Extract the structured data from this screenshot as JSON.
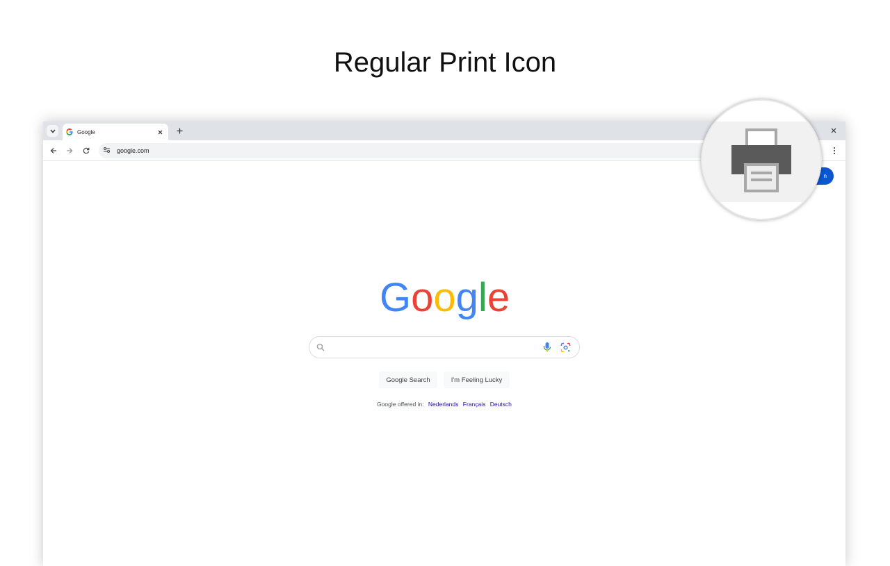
{
  "headline": "Regular Print Icon",
  "browser": {
    "tab": {
      "title": "Google"
    },
    "url": "google.com",
    "signin_label": "n"
  },
  "page": {
    "search_placeholder": "",
    "buttons": {
      "search": "Google Search",
      "lucky": "I'm Feeling Lucky"
    },
    "offered": {
      "prefix": "Google offered in:",
      "languages": [
        "Nederlands",
        "Français",
        "Deutsch"
      ]
    }
  },
  "zoom": {
    "icon": "print-icon"
  },
  "colors": {
    "accent": "#0b57d0",
    "link": "#1a0dab",
    "google_blue": "#4285f4",
    "google_red": "#ea4335",
    "google_yellow": "#fbbc05",
    "google_green": "#34a853"
  }
}
